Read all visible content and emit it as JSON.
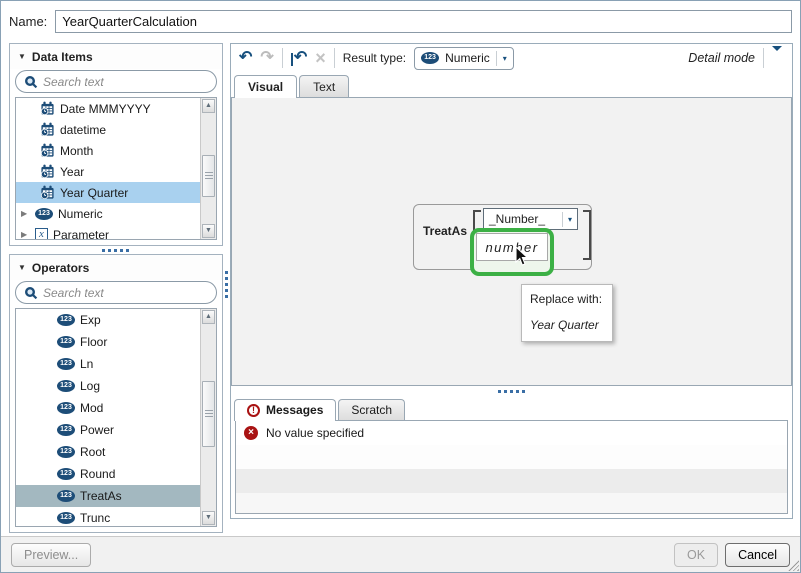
{
  "dialog": {
    "name_label": "Name:",
    "name_value": "YearQuarterCalculation"
  },
  "data_items": {
    "title": "Data Items",
    "search_placeholder": "Search text",
    "items": [
      {
        "label": "Date MMMYYYY",
        "type": "date"
      },
      {
        "label": "datetime",
        "type": "date"
      },
      {
        "label": "Month",
        "type": "date"
      },
      {
        "label": "Year",
        "type": "date"
      },
      {
        "label": "Year Quarter",
        "type": "date",
        "selected": true
      },
      {
        "label": "Numeric",
        "type": "numeric-group"
      },
      {
        "label": "Parameter",
        "type": "parameter-group"
      }
    ]
  },
  "operators": {
    "title": "Operators",
    "search_placeholder": "Search text",
    "items": [
      "Exp",
      "Floor",
      "Ln",
      "Log",
      "Mod",
      "Power",
      "Root",
      "Round",
      "TreatAs",
      "Trunc"
    ],
    "selected_item": "TreatAs"
  },
  "toolbar": {
    "result_type_label": "Result type:",
    "result_type_value": "Numeric",
    "detail_mode_label": "Detail mode"
  },
  "editor_tabs": {
    "visual": "Visual",
    "text": "Text",
    "active": "Visual"
  },
  "canvas": {
    "operator_label": "TreatAs",
    "dropdown_value": "_Number_",
    "drop_field_value": "number",
    "tooltip": {
      "line1": "Replace with:",
      "line2": "Year Quarter"
    }
  },
  "messages_panel": {
    "messages_tab": "Messages",
    "scratch_tab": "Scratch",
    "active_tab": "Messages",
    "message_text": "No value specified"
  },
  "footer": {
    "preview_label": "Preview...",
    "ok_label": "OK",
    "cancel_label": "Cancel"
  },
  "icons": {
    "numeric_badge": "123",
    "parameter_badge": "x",
    "undo": "↶",
    "redo": "↷",
    "delete": "×",
    "dropdown_arrow": "▾",
    "expand_arrow": "▶",
    "collapse_section_arrow": "▾",
    "warning_badge": "!",
    "error_badge": "×",
    "scroll_up": "▲",
    "scroll_down": "▼"
  },
  "colors": {
    "accent_navy": "#1d4d78",
    "selection_blue": "#a9d1ef",
    "selection_gray": "#a3b8c0",
    "drop_target_green": "#3cb045",
    "error_red": "#a91313"
  }
}
